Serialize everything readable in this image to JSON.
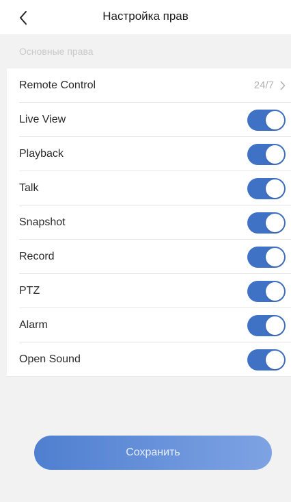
{
  "header": {
    "title": "Настройка прав",
    "back_icon": "chevron-left-icon"
  },
  "section": {
    "label": "Основные права"
  },
  "remote_control": {
    "label": "Remote Control",
    "value": "24/7"
  },
  "permissions": [
    {
      "label": "Live View",
      "enabled": true
    },
    {
      "label": "Playback",
      "enabled": true
    },
    {
      "label": "Talk",
      "enabled": true
    },
    {
      "label": "Snapshot",
      "enabled": true
    },
    {
      "label": "Record",
      "enabled": true
    },
    {
      "label": "PTZ",
      "enabled": true
    },
    {
      "label": "Alarm",
      "enabled": true
    },
    {
      "label": "Open Sound",
      "enabled": true
    }
  ],
  "save_button": {
    "label": "Сохранить"
  },
  "colors": {
    "toggle_on": "#3f71c4",
    "button_start": "#4f7fd0",
    "button_end": "#7ea3e3"
  }
}
